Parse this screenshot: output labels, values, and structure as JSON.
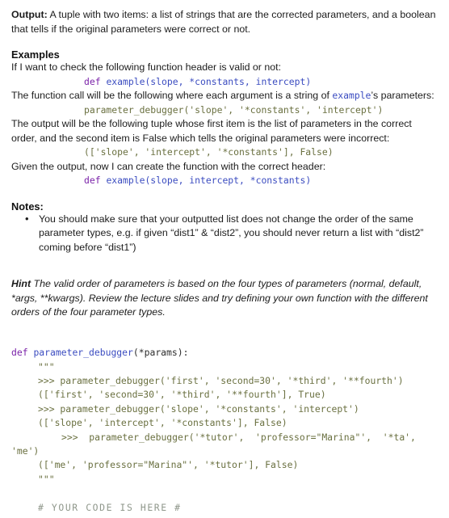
{
  "document": {
    "output_section": {
      "label": "Output:",
      "text": " A tuple with two items: a list of strings that are the corrected parameters, and a boolean that tells if the original parameters were correct or not."
    },
    "examples_section": {
      "heading": "Examples",
      "intro": "If I want to check the following function header is valid or not:",
      "code_header": {
        "keyword": "def ",
        "signature": "example(slope, *constants, intercept)"
      },
      "call_text_1": "The function call will be the following where each argument is a string of ",
      "call_inline_code": "example",
      "call_text_2": "’s parameters:",
      "code_call": "parameter_debugger('slope', '*constants', 'intercept')",
      "output_text": "The output will be the following tuple whose first item is the list of parameters in the correct order, and the second item is False which tells the original parameters were incorrect:",
      "code_result": "(['slope', 'intercept', '*constants'], False)",
      "given_text": "Given the output, now I can create the function with the correct header:",
      "code_header2": {
        "keyword": "def ",
        "signature": "example(slope, intercept, *constants)"
      }
    },
    "notes_section": {
      "heading": "Notes:",
      "items": [
        "You should make sure that your outputted list does not change the order of the same parameter types, e.g. if given “dist1” & “dist2”, you should never return a list with “dist2” coming before “dist1”)"
      ]
    },
    "hint_section": {
      "label": "Hint",
      "text": " The valid order of parameters is based on the four types of parameters (normal, default, *args, **kwargs). Review the lecture slides and try defining your own function with the different orders of the four parameter types."
    },
    "code_block": {
      "def_keyword": "def ",
      "def_name": "parameter_debugger",
      "def_args": "(*params):",
      "docstring_open": "\"\"\"",
      "lines": [
        ">>> parameter_debugger('first', 'second=30', '*third', '**fourth')",
        "(['first', 'second=30', '*third', '**fourth'], True)",
        ">>> parameter_debugger('slope', '*constants', 'intercept')",
        "(['slope', 'intercept', '*constants'], False)"
      ],
      "wrapped_line_a": ">>>  parameter_debugger('*tutor',  'professor=\"Marina\"',  '*ta',",
      "wrapped_line_b": "'me')",
      "final_result": "(['me', 'professor=\"Marina\"', '*tutor'], False)",
      "docstring_close": "\"\"\"",
      "placeholder_comment": "# YOUR CODE IS HERE #"
    }
  },
  "colors": {
    "keyword": "#7a21a8",
    "identifier": "#3b4cc0",
    "string": "#6a7040",
    "comment": "#8f978b",
    "text": "#1c1c1c",
    "background": "#ffffff"
  }
}
